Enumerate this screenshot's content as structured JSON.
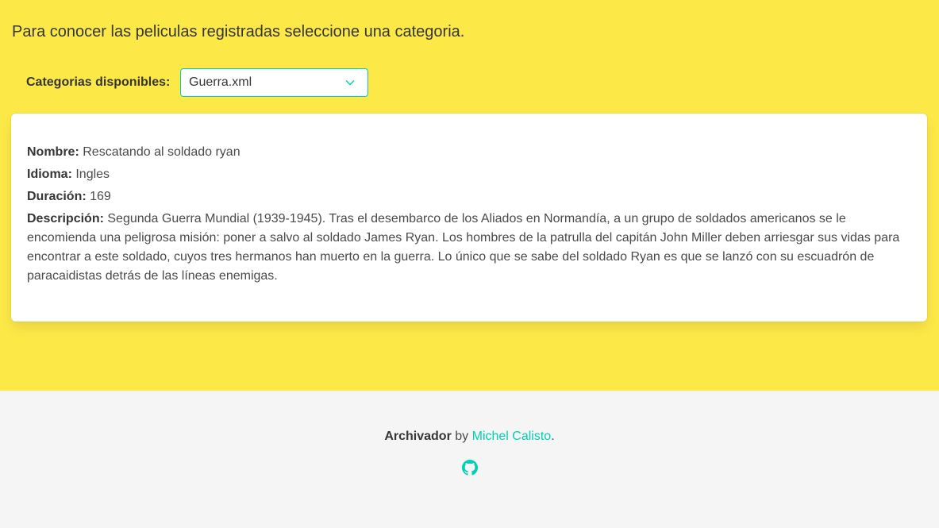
{
  "intro_text": "Para conocer las peliculas registradas seleccione una categoria.",
  "category": {
    "label": "Categorias disponibles:",
    "selected": "Guerra.xml"
  },
  "movie": {
    "name_label": "Nombre:",
    "name": "Rescatando al soldado ryan",
    "language_label": "Idioma:",
    "language": "Ingles",
    "duration_label": "Duración:",
    "duration": "169",
    "description_label": "Descripción:",
    "description": "Segunda Guerra Mundial (1939-1945). Tras el desembarco de los Aliados en Normandía, a un grupo de soldados americanos se le encomienda una peligrosa misión: poner a salvo al soldado James Ryan. Los hombres de la patrulla del capitán John Miller deben arriesgar sus vidas para encontrar a este soldado, cuyos tres hermanos han muerto en la guerra. Lo único que se sabe del soldado Ryan es que se lanzó con su escuadrón de paracaidistas detrás de las líneas enemigas."
  },
  "footer": {
    "app_name": "Archivador",
    "by": "by",
    "author": "Michel Calisto",
    "period": ".",
    "icon": "github-icon"
  },
  "colors": {
    "background": "#fce847",
    "accent": "#00d1b2",
    "footer_bg": "#f5f5f5"
  }
}
